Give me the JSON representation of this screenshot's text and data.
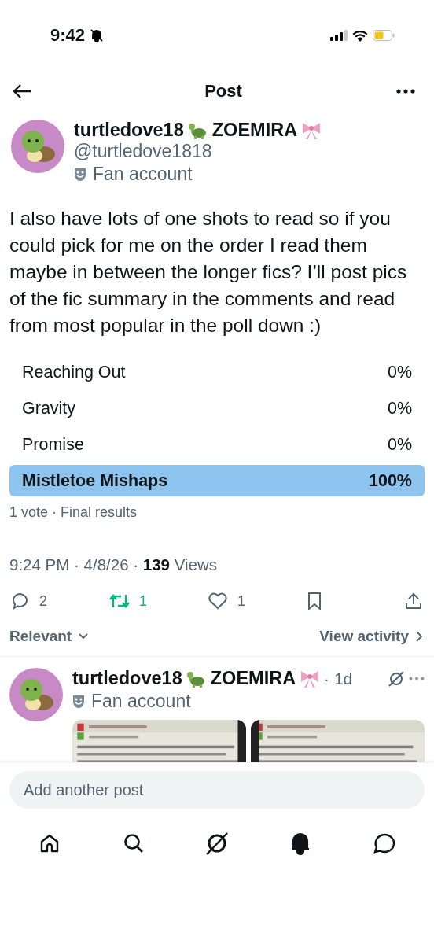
{
  "status_bar": {
    "time": "9:42",
    "silent": true
  },
  "header": {
    "title": "Post"
  },
  "post": {
    "display_name": "turtledove18",
    "display_name_suffix": "ZOEMIRA",
    "handle": "@turtledove1818",
    "label": "Fan account",
    "text": "I also have lots of one shots to read so if you could pick for me on the order I read them maybe in between the longer fics? I’ll post pics of the fic summary in the comments and read from most popular in the poll down :)",
    "poll": {
      "options": [
        {
          "label": "Reaching Out",
          "percent": "0%",
          "selected": false
        },
        {
          "label": "Gravity",
          "percent": "0%",
          "selected": false
        },
        {
          "label": "Promise",
          "percent": "0%",
          "selected": false
        },
        {
          "label": "Mistletoe Mishaps",
          "percent": "100%",
          "selected": true
        }
      ],
      "summary": "1 vote · Final results"
    },
    "time": "9:24 PM · 4/8/26 · ",
    "views_count": "139",
    "views_label": " Views",
    "actions": [
      {
        "kind": "reply",
        "count": "2",
        "active": false
      },
      {
        "kind": "repost",
        "count": "1",
        "active": true
      },
      {
        "kind": "like",
        "count": "1",
        "active": false
      },
      {
        "kind": "bookmark",
        "active": false
      },
      {
        "kind": "share",
        "active": false
      }
    ]
  },
  "sort": {
    "label": "Relevant",
    "activity": "View activity"
  },
  "reply": {
    "display_name": "turtledove18",
    "display_name_suffix": "ZOEMIRA",
    "age": "· 1d",
    "label": "Fan account"
  },
  "composer": {
    "placeholder": "Add another post"
  },
  "nav": [
    {
      "kind": "home",
      "selected": false
    },
    {
      "kind": "search",
      "selected": false
    },
    {
      "kind": "grok",
      "selected": false
    },
    {
      "kind": "notifications",
      "selected": true
    },
    {
      "kind": "messages",
      "selected": false
    }
  ]
}
